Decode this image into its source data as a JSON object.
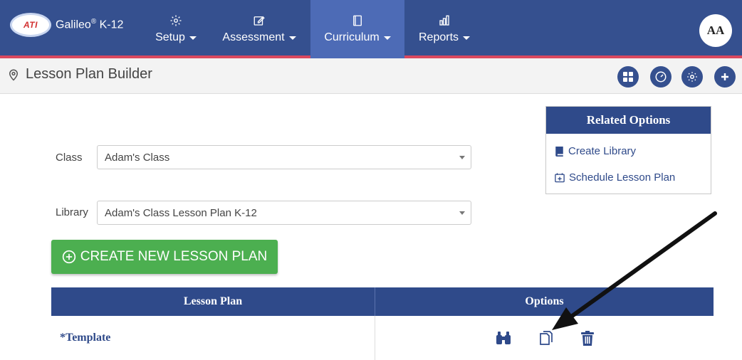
{
  "nav": {
    "logo_text": "ATI",
    "product": "Galileo",
    "product_sup": "®",
    "product_suffix": " K-12",
    "items": [
      {
        "label": "Setup",
        "icon": "gear-icon"
      },
      {
        "label": "Assessment",
        "icon": "edit-icon"
      },
      {
        "label": "Curriculum",
        "icon": "book-icon",
        "active": true
      },
      {
        "label": "Reports",
        "icon": "bar-chart-icon"
      }
    ],
    "avatar": "AA"
  },
  "subheader": {
    "title": "Lesson Plan Builder",
    "actions": [
      "dashboard-icon",
      "gauge-icon",
      "settings-icon",
      "plus-icon"
    ]
  },
  "form": {
    "class_label": "Class",
    "class_value": "Adam's Class",
    "library_label": "Library",
    "library_value": "Adam's Class Lesson Plan K-12"
  },
  "create_button": "CREATE NEW LESSON PLAN",
  "related": {
    "title": "Related Options",
    "links": [
      "Create Library",
      "Schedule Lesson Plan"
    ]
  },
  "table": {
    "headers": [
      "Lesson Plan",
      "Options"
    ],
    "rows": [
      {
        "name": "*Template",
        "options": [
          "binoculars-icon",
          "copy-icon",
          "trash-icon"
        ]
      }
    ]
  },
  "colors": {
    "navbar": "#35508f",
    "accent_red": "#d9485f",
    "active_tab": "#4d6bb6",
    "header_blue": "#2f4a8a",
    "green": "#4caf50"
  }
}
